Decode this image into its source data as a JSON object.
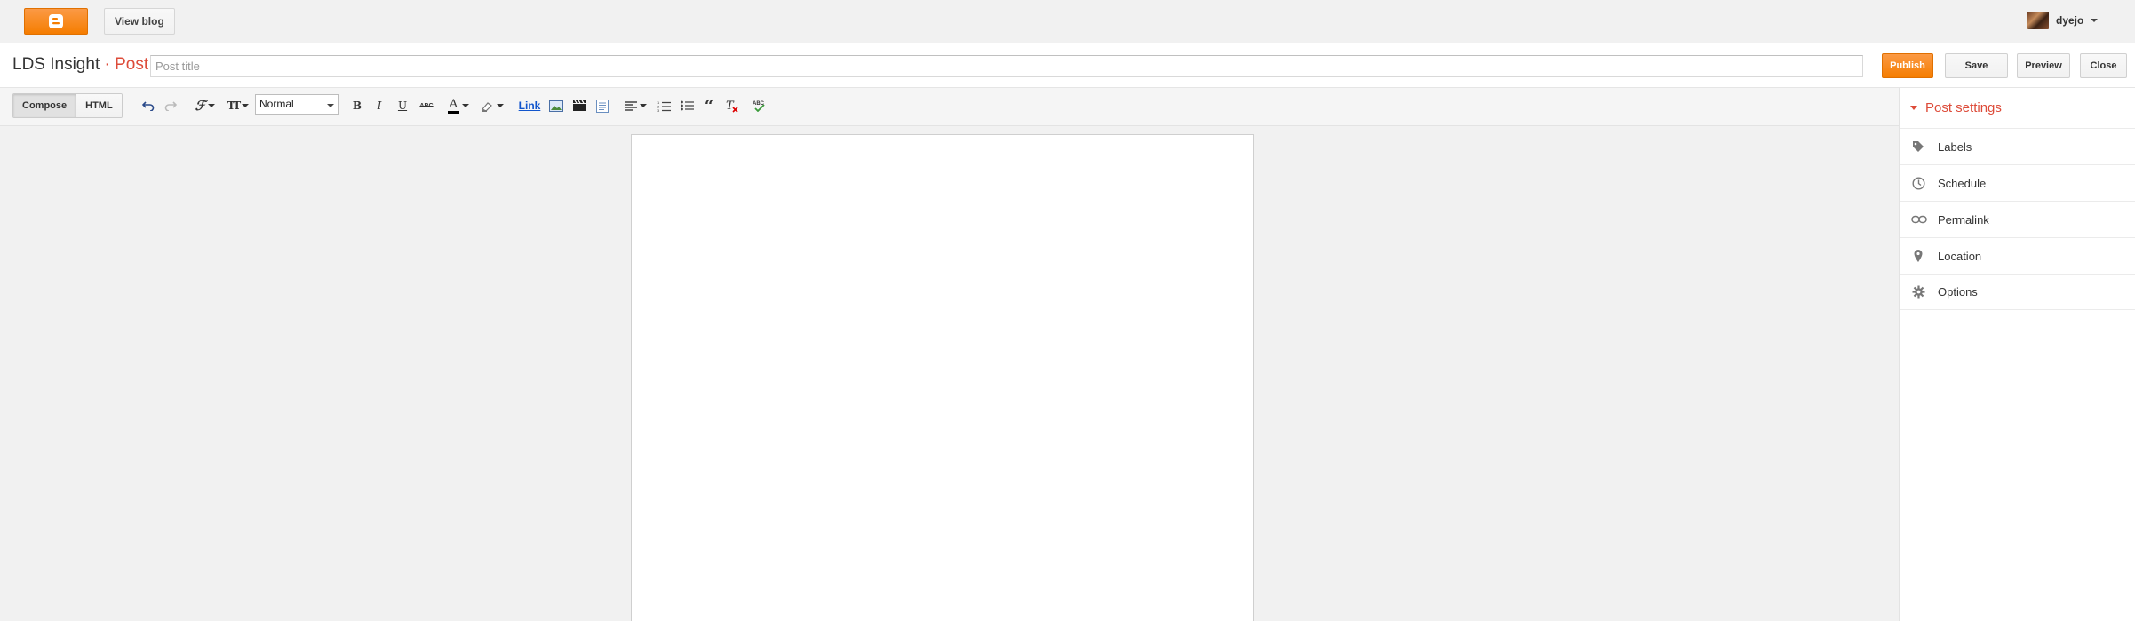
{
  "topbar": {
    "logo_icon": "blogger-logo-icon",
    "view_blog_label": "View blog",
    "user_name": "dyejo"
  },
  "titlebar": {
    "blog_name": "LDS Insight",
    "separator": "·",
    "page_kind": "Post",
    "title_placeholder": "Post title",
    "title_value": "",
    "buttons": {
      "publish": "Publish",
      "save": "Save",
      "preview": "Preview",
      "close": "Close"
    }
  },
  "toolbar": {
    "compose_label": "Compose",
    "html_label": "HTML",
    "font_size_glyph": "TT",
    "format_value": "Normal",
    "bold": "B",
    "italic": "I",
    "underline": "U",
    "strike": "ABC",
    "text_color_glyph": "A",
    "link_label": "Link",
    "icons": [
      "undo-icon",
      "redo-icon",
      "font-family-icon",
      "font-size-icon",
      "bold-icon",
      "italic-icon",
      "underline-icon",
      "strikethrough-icon",
      "text-color-icon",
      "highlight-icon",
      "link-icon",
      "image-icon",
      "video-icon",
      "jump-break-icon",
      "align-icon",
      "numbered-list-icon",
      "bullet-list-icon",
      "quote-icon",
      "remove-format-icon",
      "spellcheck-icon"
    ]
  },
  "post_settings": {
    "title": "Post settings",
    "items": [
      {
        "label": "Labels",
        "icon": "tag-icon"
      },
      {
        "label": "Schedule",
        "icon": "clock-icon"
      },
      {
        "label": "Permalink",
        "icon": "link-chain-icon"
      },
      {
        "label": "Location",
        "icon": "map-pin-icon"
      },
      {
        "label": "Options",
        "icon": "gear-icon"
      }
    ]
  },
  "colors": {
    "accent_orange": "#f57d00",
    "accent_red": "#dd4b39",
    "background": "#f1f1f1"
  }
}
